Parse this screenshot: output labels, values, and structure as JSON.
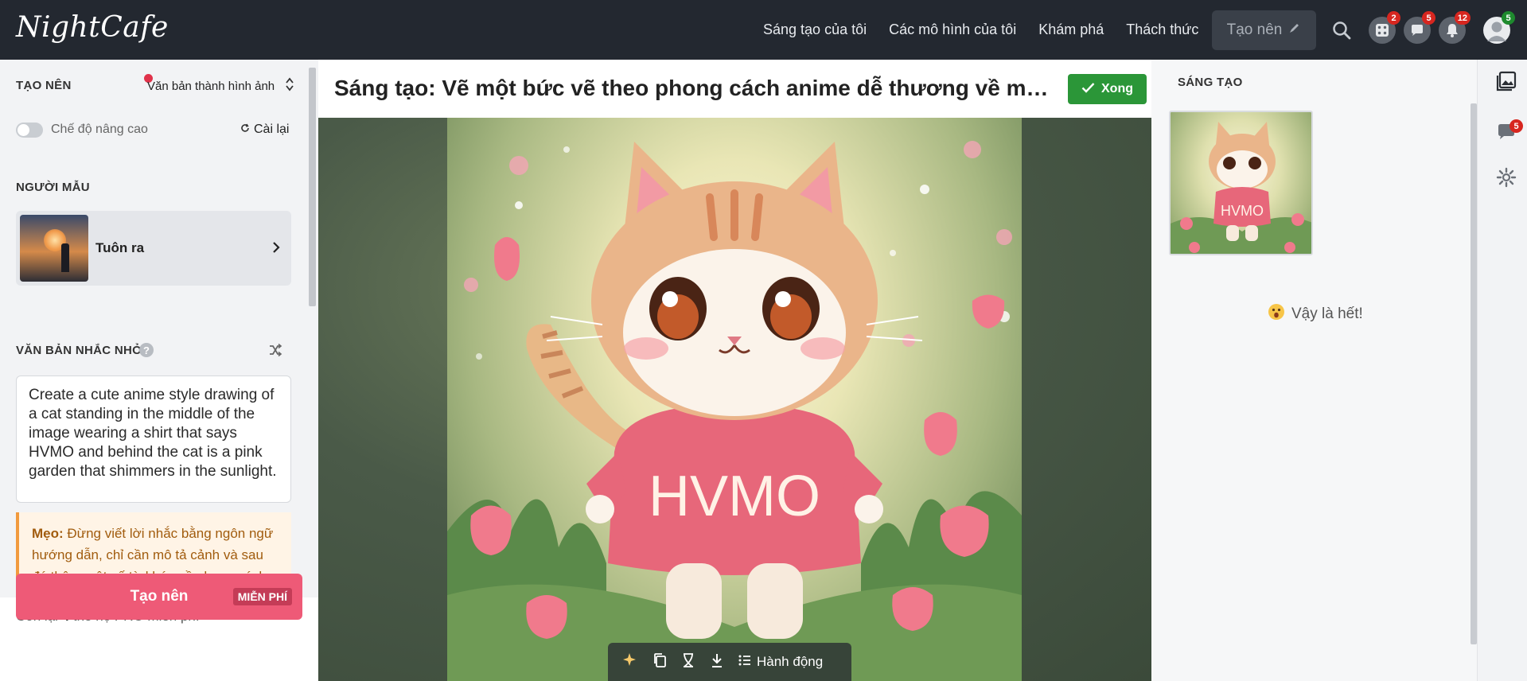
{
  "app": {
    "logo": "NightCafe"
  },
  "topnav": {
    "links": [
      "Sáng tạo của tôi",
      "Các mô hình của tôi",
      "Khám phá",
      "Thách thức"
    ],
    "create_label": "Tạo nên",
    "icons": [
      {
        "name": "search-icon"
      },
      {
        "name": "dice-icon",
        "badge": "2"
      },
      {
        "name": "chat-icon",
        "badge": "5"
      },
      {
        "name": "bell-icon",
        "badge": "12"
      },
      {
        "name": "avatar-icon",
        "badge": "5"
      }
    ]
  },
  "left_panel": {
    "section_create": "TẠO NÊN",
    "mode_value": "Văn bản thành hình ảnh",
    "advanced_mode_label": "Chế độ nâng cao",
    "reset_label": "Cài lại",
    "section_model": "NGƯỜI MẪU",
    "model_name": "Tuôn ra",
    "section_prompt": "VĂN BẢN NHẮC NHỞ",
    "prompt_text": "Create a cute anime style drawing of a cat standing in the middle of the image wearing a shirt that says HVMO and behind the cat is a pink garden that shimmers in the sunlight.",
    "tip_label": "Mẹo:",
    "tip_text": "Đừng viết lời nhắc bằng ngôn ngữ hướng dẫn, chỉ cần mô tả cảnh và sau đó thêm một số từ khóa về phong cách. Ví dụ, thay vì \"Tạo cho tôi một bức",
    "remaining_prefix": "Còn lại",
    "remaining_count": "4",
    "remaining_suffix": "thế hệ PRO miễn phí",
    "generate_label": "Tạo nên",
    "free_tag": "MIỄN PHÍ"
  },
  "center": {
    "title": "Sáng tạo: Vẽ một bức vẽ theo phong cách anime dễ thương về một con mèo",
    "done_label": "Xong",
    "shirt_text": "HVMO",
    "actions_label": "Hành động"
  },
  "right_panel": {
    "title": "SÁNG TẠO",
    "thumb_shirt_text": "HVMO",
    "end_text": "Vậy là hết!",
    "rail_badge": "5"
  },
  "colors": {
    "topbar": "#232830",
    "generate_button": "#ee5a77",
    "done_button": "#2b9638",
    "badge_red": "#d7261f",
    "badge_green": "#1e8a2e",
    "tip_border": "#f19a3e"
  }
}
